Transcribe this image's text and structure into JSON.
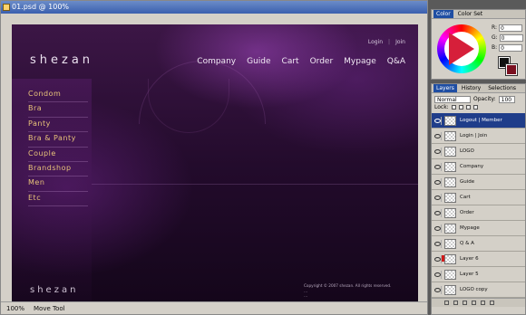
{
  "document": {
    "title": "01.psd @ 100%",
    "zoom": "100%",
    "tool": "Move Tool"
  },
  "design": {
    "logo": "shezan",
    "util_links": [
      "Login",
      "|",
      "Join"
    ],
    "nav": [
      "Company",
      "Guide",
      "Cart",
      "Order",
      "Mypage",
      "Q&A"
    ],
    "menu": [
      "Condom",
      "Bra",
      "Panty",
      "Bra & Panty",
      "Couple",
      "Brandshop",
      "Men",
      "Etc"
    ],
    "footer_logo": "shezan",
    "copyright": [
      "Copyright © 2007 shezan. All rights reserved.",
      "…",
      "…",
      "…"
    ]
  },
  "color_panel": {
    "tabs": [
      "Color",
      "Color Set"
    ],
    "active_tab": "Color",
    "fields": [
      {
        "label": "R:",
        "value": "0"
      },
      {
        "label": "G:",
        "value": "0"
      },
      {
        "label": "B:",
        "value": "0"
      }
    ],
    "fg_color": "#111111",
    "bg_color": "#7a1020"
  },
  "layers_panel": {
    "tabs": [
      "Layers",
      "History",
      "Selections"
    ],
    "active_tab": "Layers",
    "blend_mode": "Normal",
    "opacity_label": "Opacity:",
    "opacity_value": "100",
    "lock_label": "Lock:",
    "layers": [
      {
        "name": "Logout | Member",
        "active": true
      },
      {
        "name": "Login | Join",
        "active": false
      },
      {
        "name": "LOGO",
        "active": false
      },
      {
        "name": "Company",
        "active": false
      },
      {
        "name": "Guide",
        "active": false
      },
      {
        "name": "Cart",
        "active": false
      },
      {
        "name": "Order",
        "active": false
      },
      {
        "name": "Mypage",
        "active": false
      },
      {
        "name": "Q & A",
        "active": false
      },
      {
        "name": "Layer 6",
        "active": false
      },
      {
        "name": "Layer 5",
        "active": false
      },
      {
        "name": "LOGO copy",
        "active": false
      }
    ]
  }
}
